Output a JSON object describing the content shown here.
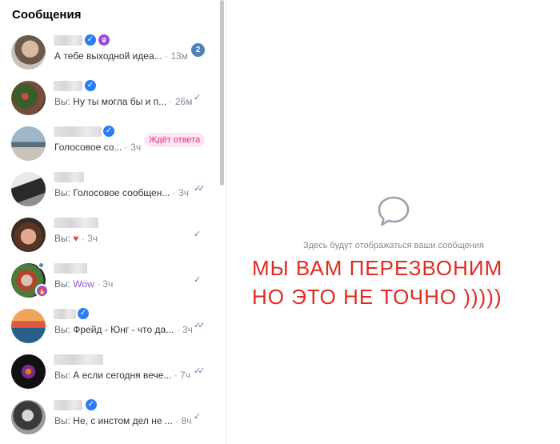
{
  "sidebar": {
    "title": "Сообщения",
    "chats": [
      {
        "you": "",
        "text": "А тебе выходной идеа...",
        "sep": " · ",
        "time": "13м",
        "badge": "2"
      },
      {
        "you": "Вы: ",
        "text": "Ну ты могла бы и п...",
        "sep": " · ",
        "time": "26м",
        "status": "✓"
      },
      {
        "you": "",
        "text": "Голосовое со...",
        "sep": " · ",
        "time": "3ч",
        "pill": "Ждёт ответа"
      },
      {
        "you": "Вы: ",
        "text": "Голосовое сообщен...",
        "sep": " · ",
        "time": "3ч",
        "status": "✓✓"
      },
      {
        "you": "Вы: ",
        "text": "",
        "sep": " · ",
        "time": "3ч",
        "status": "✓",
        "heart": "♥"
      },
      {
        "you": "Вы: ",
        "text": "Wow",
        "sep": " · ",
        "time": "3ч",
        "status": "✓"
      },
      {
        "you": "Вы: ",
        "text": "Фрейд - Юнг - что да...",
        "sep": " · ",
        "time": "3ч",
        "status": "✓✓"
      },
      {
        "you": "Вы: ",
        "text": "А если сегодня вече...",
        "sep": " · ",
        "time": "7ч",
        "status": "✓✓"
      },
      {
        "you": "Вы: ",
        "text": "Не, с инстом дел не ...",
        "sep": " · ",
        "time": "8ч",
        "status": "✓"
      }
    ]
  },
  "empty_state": {
    "icon": "chat-bubble-icon",
    "text": "Здесь будут отображаться ваши сообщения"
  },
  "overlay": {
    "line1": "МЫ ВАМ ПЕРЕЗВОНИМ",
    "line2": "НО ЭТО НЕ ТОЧНО )))))"
  },
  "colors": {
    "accent": "#5181b8",
    "verified": "#2a7cf7",
    "overlay_text": "#e12b20",
    "pill_bg": "#fde6f1",
    "pill_text": "#e0307f"
  }
}
